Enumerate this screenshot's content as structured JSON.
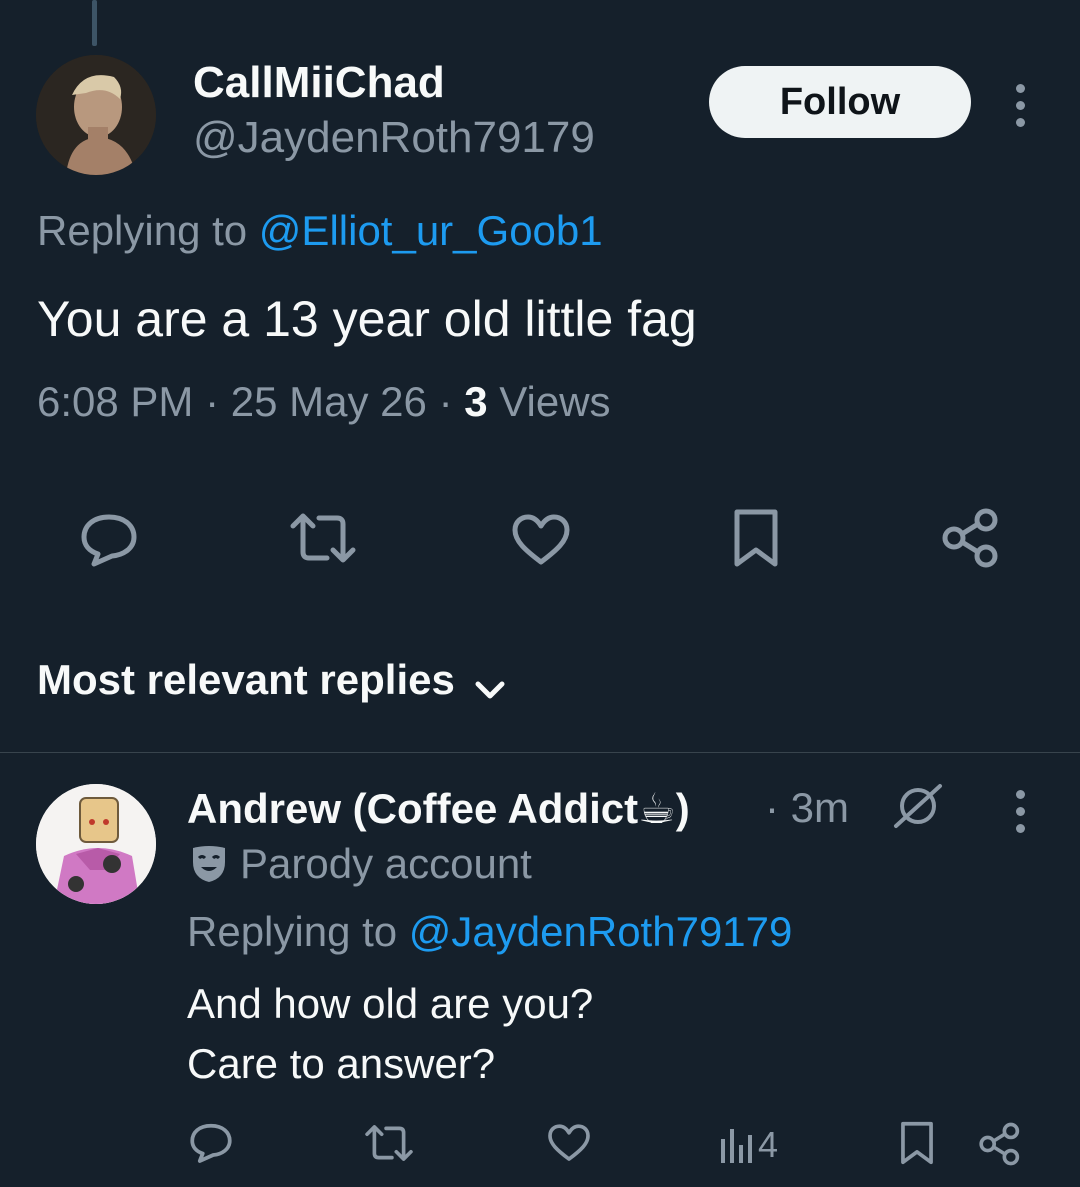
{
  "tweet": {
    "display_name": "CallMiiChad",
    "handle": "@JaydenRoth79179",
    "follow_label": "Follow",
    "replying_prefix": "Replying to",
    "replying_handle": "@Elliot_ur_Goob1",
    "text": "You are a 13 year old little fag",
    "time": "6:08 PM",
    "sep1": "·",
    "date": "25 May 26",
    "sep2": "·",
    "views_count": "3",
    "views_label": "Views",
    "actions": [
      "reply-icon",
      "retweet-icon",
      "like-icon",
      "bookmark-icon",
      "share-icon"
    ]
  },
  "replies_section": {
    "title": "Most relevant replies"
  },
  "reply": {
    "display_name": "Andrew (Coffee Addict",
    "emoji": "☕",
    "name_close": ")",
    "time": "· 3m",
    "parody_label": "Parody account",
    "replying_prefix": "Replying to",
    "replying_handle": "@JaydenRoth79179",
    "text_line1": "And how old are you?",
    "text_line2": "Care to answer?",
    "views": "4"
  },
  "colors": {
    "background": "#15202b",
    "text_primary": "#f7f9f9",
    "text_secondary": "#8b98a5",
    "accent": "#1d9bf0",
    "divider": "#38444d"
  }
}
